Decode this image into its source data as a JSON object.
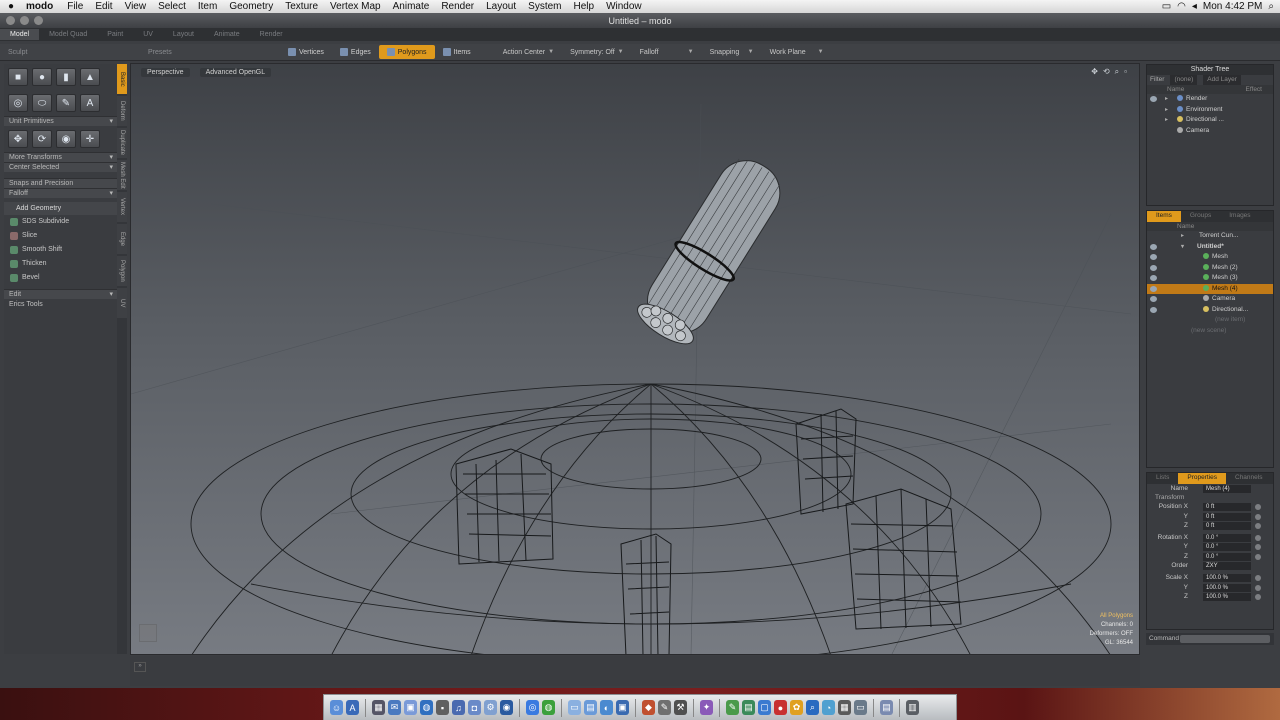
{
  "menubar": {
    "apple": "",
    "app_name": "modo",
    "items": [
      "File",
      "Edit",
      "View",
      "Select",
      "Item",
      "Geometry",
      "Texture",
      "Vertex Map",
      "Animate",
      "Render",
      "Layout",
      "System",
      "Help",
      "Window"
    ],
    "clock": "Mon 4:42 PM"
  },
  "window": {
    "title": "Untitled – modo"
  },
  "layout_tabs": [
    "Model",
    "Model Quad",
    "Paint",
    "UV",
    "Layout",
    "Animate",
    "Render"
  ],
  "toolbar": {
    "sculpt": "Sculpt",
    "presets": "Presets",
    "modes": [
      "Vertices",
      "Edges",
      "Polygons",
      "Items"
    ],
    "active_mode": "Polygons",
    "action_center": "Action Center",
    "symmetry": "Symmetry: Off",
    "falloff": "Falloff",
    "snapping": "Snapping",
    "work_plane": "Work Plane"
  },
  "left_panel": {
    "unit_primitives": "Unit Primitives",
    "more_transforms": "More Transforms",
    "center_selected": "Center Selected",
    "snaps_precision": "Snaps and Precision",
    "falloff": "Falloff",
    "add_geometry": "Add Geometry",
    "tools": [
      "SDS Subdivide",
      "Slice",
      "Smooth Shift",
      "Thicken",
      "Bevel"
    ],
    "edit": "Edit",
    "erics_tools": "Erics Tools"
  },
  "vertical_tabs": [
    "Basic",
    "Deform",
    "Duplicate",
    "Mesh Edit",
    "Vertex",
    "Edge",
    "Polygon",
    "UV"
  ],
  "viewport": {
    "view_type": "Perspective",
    "render_mode": "Advanced OpenGL",
    "stats": {
      "selection": "All Polygons",
      "channels": "Channels: 0",
      "deformers": "Deformers: OFF",
      "gl": "GL: 36544"
    }
  },
  "shader_tree": {
    "title": "Shader Tree",
    "filter_label": "Filter",
    "filter_value": "(none)",
    "add_layer": "Add Layer",
    "col_name": "Name",
    "col_effect": "Effect",
    "items": [
      "Render",
      "Environment",
      "Directional ...",
      "Camera"
    ]
  },
  "items_panel": {
    "tabs": [
      "Items",
      "Groups",
      "Images"
    ],
    "col_name": "Name",
    "items": [
      "Torrent Cun...",
      "Untitled*",
      "Mesh",
      "Mesh (2)",
      "Mesh (3)",
      "Mesh (4)",
      "Camera",
      "Directional...",
      "(new item)",
      "(new scene)"
    ],
    "selected": "Mesh (4)"
  },
  "properties": {
    "tabs": [
      "Lists",
      "Properties",
      "Channels"
    ],
    "name_label": "Name",
    "name_value": "Mesh (4)",
    "section": "Transform",
    "rows": [
      {
        "label": "Position X",
        "value": "0 ft"
      },
      {
        "label": "Y",
        "value": "0 ft"
      },
      {
        "label": "Z",
        "value": "0 ft"
      },
      {
        "label": "Rotation X",
        "value": "0.0 °"
      },
      {
        "label": "Y",
        "value": "0.0 °"
      },
      {
        "label": "Z",
        "value": "0.0 °"
      },
      {
        "label": "Order",
        "value": "ZXY"
      },
      {
        "label": "Scale X",
        "value": "100.0 %"
      },
      {
        "label": "Y",
        "value": "100.0 %"
      },
      {
        "label": "Z",
        "value": "100.0 %"
      }
    ]
  },
  "command": {
    "label": "Command"
  },
  "colors": {
    "accent": "#e09a1c",
    "selection": "#c17a17",
    "panel_bg": "#3a3c40"
  }
}
